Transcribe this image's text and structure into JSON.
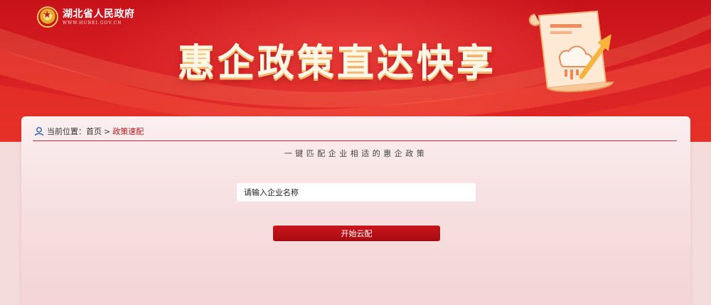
{
  "header": {
    "site_name": "湖北省人民政府",
    "site_url": "WWW.HUBEI.GOV.CN",
    "hero_title": "惠企政策直达快享"
  },
  "breadcrumb": {
    "prefix": "当前位置：",
    "home": "首页",
    "separator": ">",
    "current": "政策速配"
  },
  "main": {
    "subtitle": "一键匹配企业相适的惠企政策",
    "company_input": {
      "placeholder": "请输入企业名称",
      "value": ""
    },
    "start_button_label": "开始云配"
  },
  "colors": {
    "brand_red": "#c8151b",
    "banner_red": "#d61d22",
    "divider": "#b5353a",
    "card_bg": "#f7e1e2"
  },
  "icons": {
    "emblem": "national-emblem-icon",
    "location": "user-location-icon",
    "illustration": "document-cloud-arrow-icon"
  }
}
